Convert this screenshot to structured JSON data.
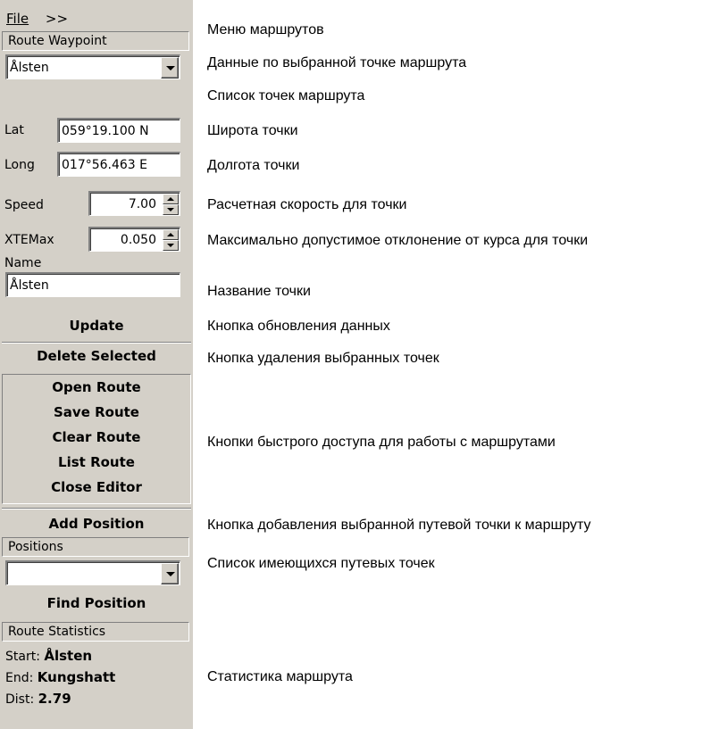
{
  "menu": {
    "file_label": "File",
    "more_label": ">>"
  },
  "route_waypoint": {
    "header": "Route Waypoint",
    "selected_point": "Ålsten",
    "lat_label": "Lat",
    "lat_value": "059°19.100 N",
    "long_label": "Long",
    "long_value": "017°56.463 E",
    "speed_label": "Speed",
    "speed_value": "7.00",
    "xte_label": "XTEMax",
    "xte_value": "0.050",
    "name_label": "Name",
    "name_value": "Ålsten",
    "update_label": "Update"
  },
  "delete_label": "Delete Selected",
  "route_buttons": [
    "Open Route",
    "Save Route",
    "Clear Route",
    "List Route",
    "Close Editor"
  ],
  "add_position_label": "Add Position",
  "positions": {
    "header": "Positions",
    "selected": "",
    "find_label": "Find Position"
  },
  "statistics": {
    "header": "Route Statistics",
    "start_label": "Start:",
    "start_value": "Ålsten",
    "end_label": "End:",
    "end_value": "Kungshatt",
    "dist_label": "Dist:",
    "dist_value": "2.79"
  },
  "descriptions": {
    "menu": "Меню маршрутов",
    "waypoint_data": "Данные по выбранной точке маршрута",
    "point_list": "Список точек маршрута",
    "lat": "Широта точки",
    "long": "Долгота точки",
    "speed": "Расчетная скорость для точки",
    "xte": "Максимально допустимое отклонение от курса для точки",
    "name": "Название точки",
    "update": "Кнопка обновления данных",
    "delete": "Кнопка удаления выбранных точек",
    "route_buttons": "Кнопки быстрого доступа для работы с маршрутами",
    "add_position": "Кнопка добавления выбранной путевой точки к маршруту",
    "positions": "Список имеющихся путевых точек",
    "statistics": "Статистика маршрута"
  }
}
